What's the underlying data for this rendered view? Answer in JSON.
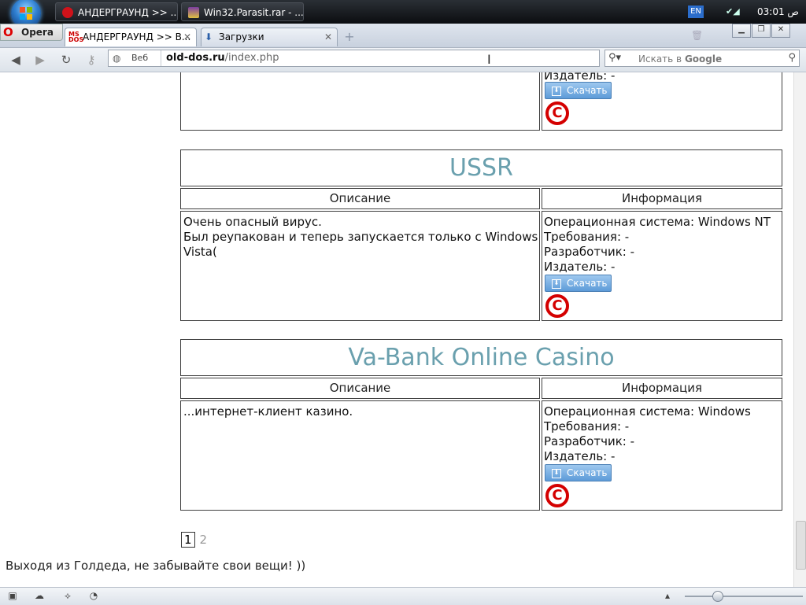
{
  "taskbar": {
    "tasks": [
      {
        "label": "АНДЕРГРАУНД >> ..."
      },
      {
        "label": "Win32.Parasit.rar - ..."
      }
    ],
    "lang": "EN",
    "time": "03:01 ص"
  },
  "browser": {
    "menu_label": "Opera",
    "tabs": [
      {
        "label": "АНДЕРГРАУНД >> В..."
      },
      {
        "label": "Загрузки"
      }
    ],
    "address": {
      "mode_label": "Веб",
      "domain": "old-dos.ru",
      "path": "/index.php"
    },
    "search": {
      "placeholder_prefix": "Искать в ",
      "placeholder_engine": "Google"
    }
  },
  "page": {
    "labels": {
      "publisher_prefix": "Издатель: -",
      "download": "Скачать",
      "col_description": "Описание",
      "col_info": "Информация",
      "requirements": "Требования: -",
      "developer": "Разработчик: -",
      "publisher": "Издатель: -"
    },
    "entries": [
      {
        "title": "USSR",
        "description_lines": [
          "Очень опасный вирус.",
          "Был реупакован и теперь запускается только с Windows",
          "Vista("
        ],
        "os": "Операционная система: Windows NT"
      },
      {
        "title": "Va-Bank Online Casino",
        "description_lines": [
          "...интернет-клиент казино."
        ],
        "os": "Операционная система: Windows"
      }
    ],
    "pagination": {
      "current": "1",
      "next": "2"
    },
    "footer": "Выходя из Голдеда, не забывайте свои вещи! ))"
  }
}
